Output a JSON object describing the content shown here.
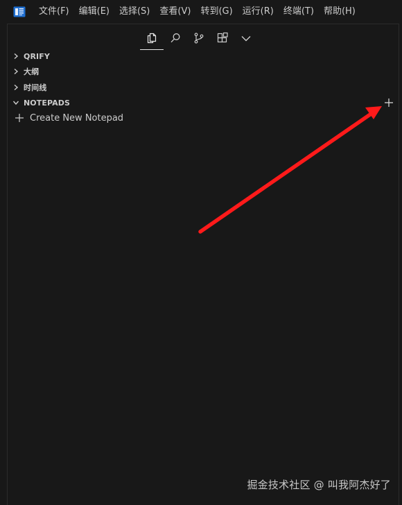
{
  "menubar": {
    "logo_icon": "cursor-app-icon",
    "items": [
      {
        "label": "文件(F)"
      },
      {
        "label": "编辑(E)"
      },
      {
        "label": "选择(S)"
      },
      {
        "label": "查看(V)"
      },
      {
        "label": "转到(G)"
      },
      {
        "label": "运行(R)"
      },
      {
        "label": "终端(T)"
      },
      {
        "label": "帮助(H)"
      }
    ]
  },
  "activity_tabs": [
    {
      "icon": "explorer-icon",
      "active": true
    },
    {
      "icon": "search-icon",
      "active": false
    },
    {
      "icon": "source-control-icon",
      "active": false
    },
    {
      "icon": "extensions-icon",
      "active": false
    },
    {
      "icon": "chevron-down-icon",
      "active": false
    }
  ],
  "sections": [
    {
      "title": "QRIFY",
      "expanded": false
    },
    {
      "title": "大纲",
      "expanded": false
    },
    {
      "title": "时间线",
      "expanded": false
    },
    {
      "title": "NOTEPADS",
      "expanded": true
    }
  ],
  "notepads": {
    "add_action_icon": "plus-icon",
    "create_label": "Create New Notepad"
  },
  "annotation": {
    "arrow_color": "#ff1a1a"
  },
  "watermark": {
    "text": "掘金技术社区 @ 叫我阿杰好了"
  },
  "colors": {
    "background": "#181818",
    "text": "#cccccc",
    "logo_blue": "#3794ff"
  }
}
